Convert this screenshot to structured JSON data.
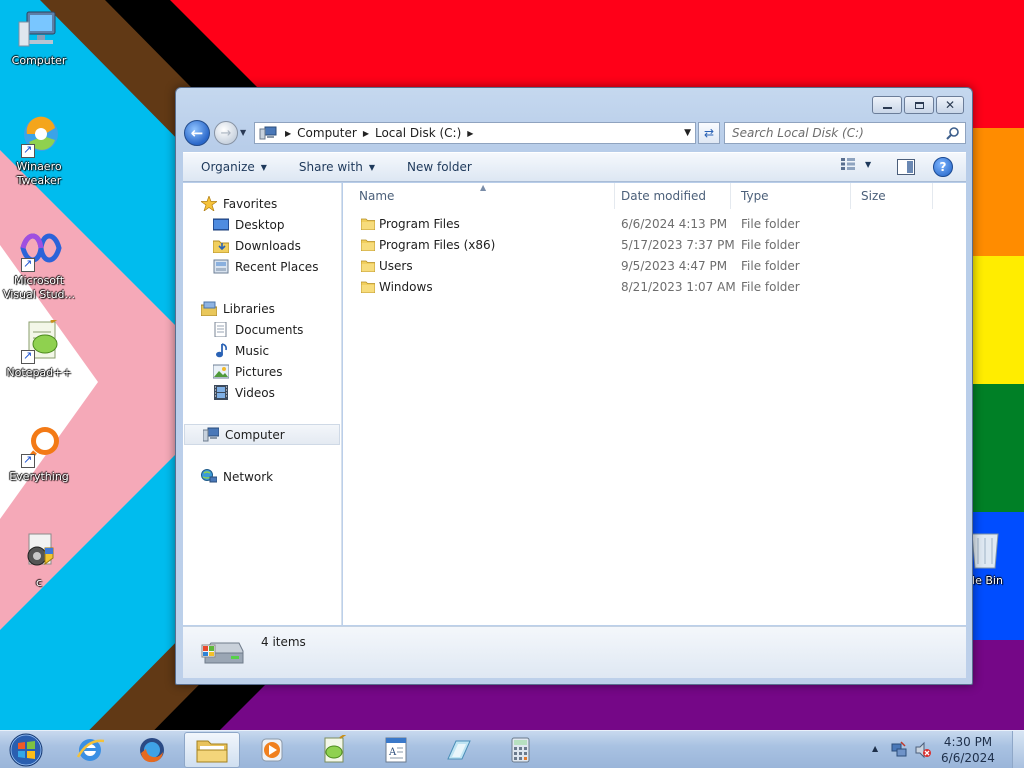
{
  "desktop": {
    "icons": [
      {
        "label": "Computer"
      },
      {
        "label": "Winaero Tweaker"
      },
      {
        "label": "Microsoft Visual Stud..."
      },
      {
        "label": "Notepad++"
      },
      {
        "label": "Everything"
      },
      {
        "label": "c"
      },
      {
        "label": "cle Bin"
      }
    ]
  },
  "window": {
    "address": {
      "crumbs": [
        "Computer",
        "Local Disk (C:)"
      ]
    },
    "search": {
      "placeholder": "Search Local Disk (C:)"
    },
    "commands": {
      "organize": "Organize",
      "share_with": "Share with",
      "new_folder": "New folder"
    },
    "nav": {
      "favorites": "Favorites",
      "desktop": "Desktop",
      "downloads": "Downloads",
      "recent_places": "Recent Places",
      "libraries": "Libraries",
      "documents": "Documents",
      "music": "Music",
      "pictures": "Pictures",
      "videos": "Videos",
      "computer": "Computer",
      "network": "Network"
    },
    "columns": {
      "name": "Name",
      "date_modified": "Date modified",
      "type": "Type",
      "size": "Size"
    },
    "files": [
      {
        "name": "Program Files",
        "date": "6/6/2024 4:13 PM",
        "type": "File folder"
      },
      {
        "name": "Program Files (x86)",
        "date": "5/17/2023 7:37 PM",
        "type": "File folder"
      },
      {
        "name": "Users",
        "date": "9/5/2023 4:47 PM",
        "type": "File folder"
      },
      {
        "name": "Windows",
        "date": "8/21/2023 1:07 AM",
        "type": "File folder"
      }
    ],
    "status": {
      "item_count": "4 items"
    }
  },
  "taskbar": {
    "clock": {
      "time": "4:30 PM",
      "date": "6/6/2024"
    }
  }
}
